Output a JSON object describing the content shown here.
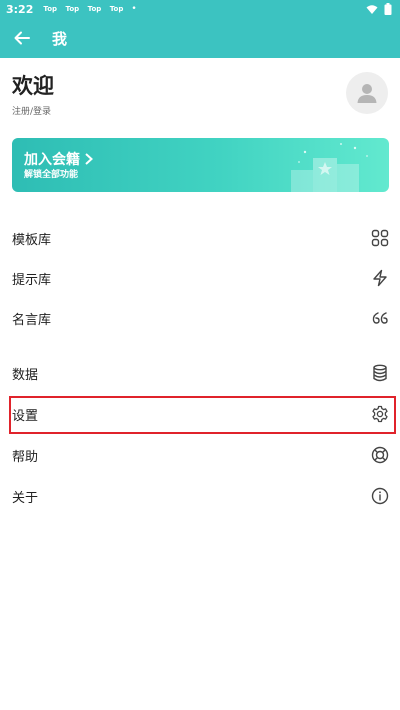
{
  "status_bar": {
    "time": "3:22",
    "notifications": [
      "Top",
      "Top",
      "Top",
      "Top"
    ],
    "dot": "•"
  },
  "app_bar": {
    "title": "我"
  },
  "profile": {
    "welcome": "欢迎",
    "login_link": "注册/登录"
  },
  "banner": {
    "title": "加入会籍",
    "subtitle": "解锁全部功能"
  },
  "menu": [
    {
      "label": "模板库",
      "icon": "grid-icon"
    },
    {
      "label": "提示库",
      "icon": "lightning-icon"
    },
    {
      "label": "名言库",
      "icon": "quote-icon"
    },
    {
      "label": "数据",
      "icon": "database-icon"
    },
    {
      "label": "设置",
      "icon": "gear-icon"
    },
    {
      "label": "帮助",
      "icon": "lifebuoy-icon"
    },
    {
      "label": "关于",
      "icon": "info-icon"
    }
  ],
  "colors": {
    "accent": "#3cc3c1",
    "highlight": "#e0232b"
  }
}
